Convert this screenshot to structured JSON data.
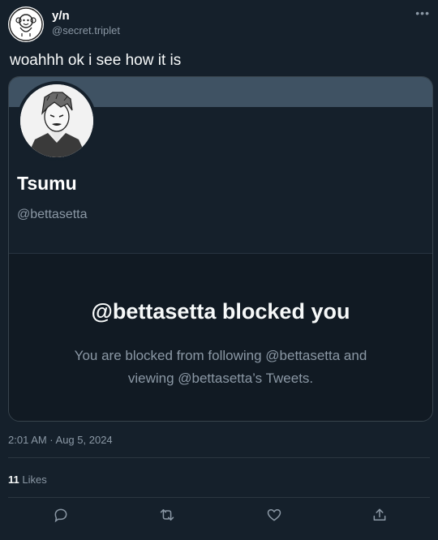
{
  "author": {
    "display_name": "y/n",
    "handle": "@secret.triplet",
    "avatar_icon": "monkey-logo-icon"
  },
  "more_icon": "ellipsis-icon",
  "tweet": {
    "text": "woahhh ok i see how it is",
    "timestamp": "2:01 AM · Aug 5, 2024"
  },
  "quoted_profile": {
    "name": "Tsumu",
    "handle": "@bettasetta",
    "blocked_title": "@bettasetta blocked you",
    "blocked_description": "You are blocked from following @bettasetta and viewing @bettasetta’s Tweets."
  },
  "stats": {
    "likes_count": "11",
    "likes_label": "Likes"
  },
  "actions": {
    "reply_icon": "reply-icon",
    "retweet_icon": "retweet-icon",
    "like_icon": "heart-icon",
    "share_icon": "share-icon"
  },
  "colors": {
    "background": "#15202b",
    "secondary_text": "#8b98a5",
    "banner": "#3f5263"
  }
}
